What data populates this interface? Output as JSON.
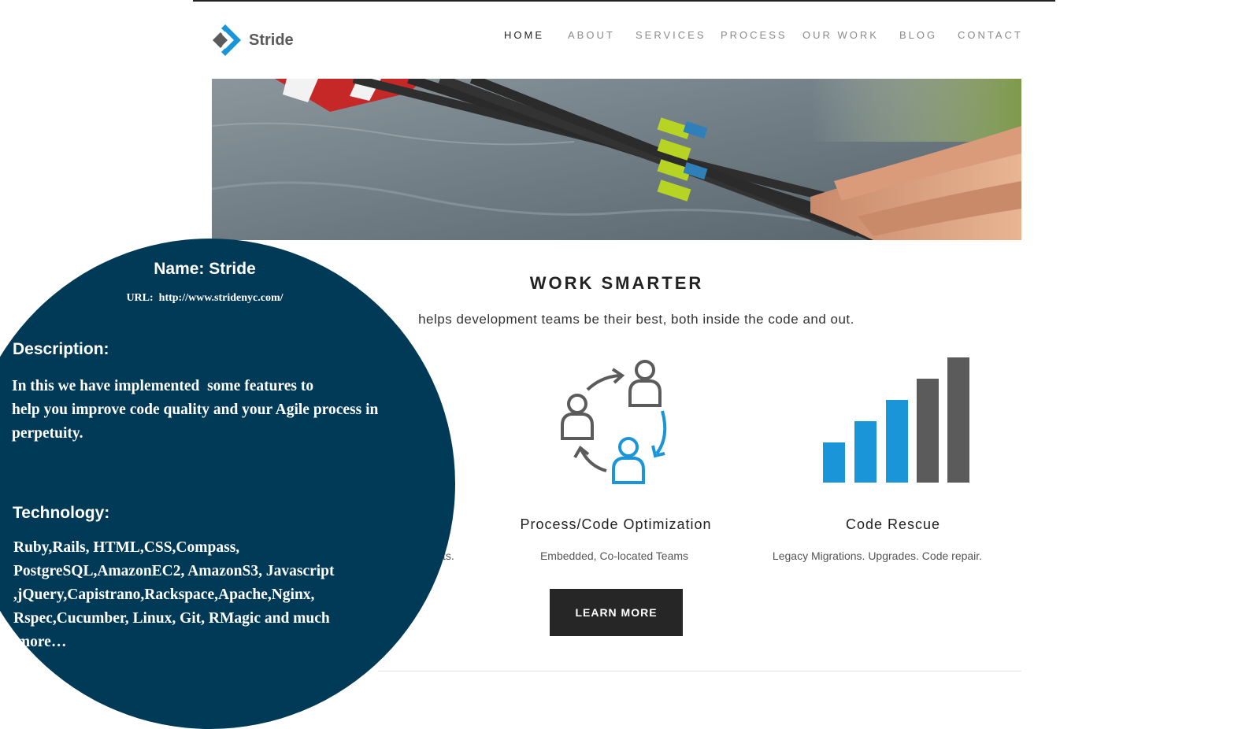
{
  "site": {
    "logo_text": "Stride",
    "nav": [
      "HOME",
      "ABOUT",
      "SERVICES",
      "PROCESS",
      "OUR WORK",
      "BLOG",
      "CONTACT"
    ],
    "active_nav": "HOME"
  },
  "hero": {
    "alt": "Rowing oars and hands on water"
  },
  "main": {
    "title": "WORK SMARTER",
    "intro": "helps development teams be their best, both inside the code and out.",
    "cards": [
      {
        "title": "Process/Code Optimization",
        "subtitle": "Embedded, Co-located Teams"
      },
      {
        "title": "Code Rescue",
        "subtitle": "Legacy Migrations. Upgrades. Code repair."
      }
    ],
    "partial_left_text": "cts.",
    "learn_more": "LEARN MORE"
  },
  "colors": {
    "accent_blue": "#1a96d8",
    "dark_gray": "#5b5b5b",
    "overlay": "#003a56",
    "button": "#262626"
  },
  "overlay": {
    "name": "Name: Stride",
    "url": "URL:  http://www.stridenyc.com/",
    "description_heading": "Description:",
    "description_lines": [
      "In this we have implemented  some features to",
      "help you improve code quality and your Agile process in",
      "perpetuity."
    ],
    "technology_heading": "Technology:",
    "technology_lines": [
      "Ruby,Rails, HTML,CSS,Compass,",
      "PostgreSQL,AmazonEC2, AmazonS3, Javascript",
      ",jQuery,Capistrano,Rackspace,Apache,Nginx,",
      "Rspec,Cucumber, Linux, Git, RMagic and much",
      " more…"
    ]
  }
}
